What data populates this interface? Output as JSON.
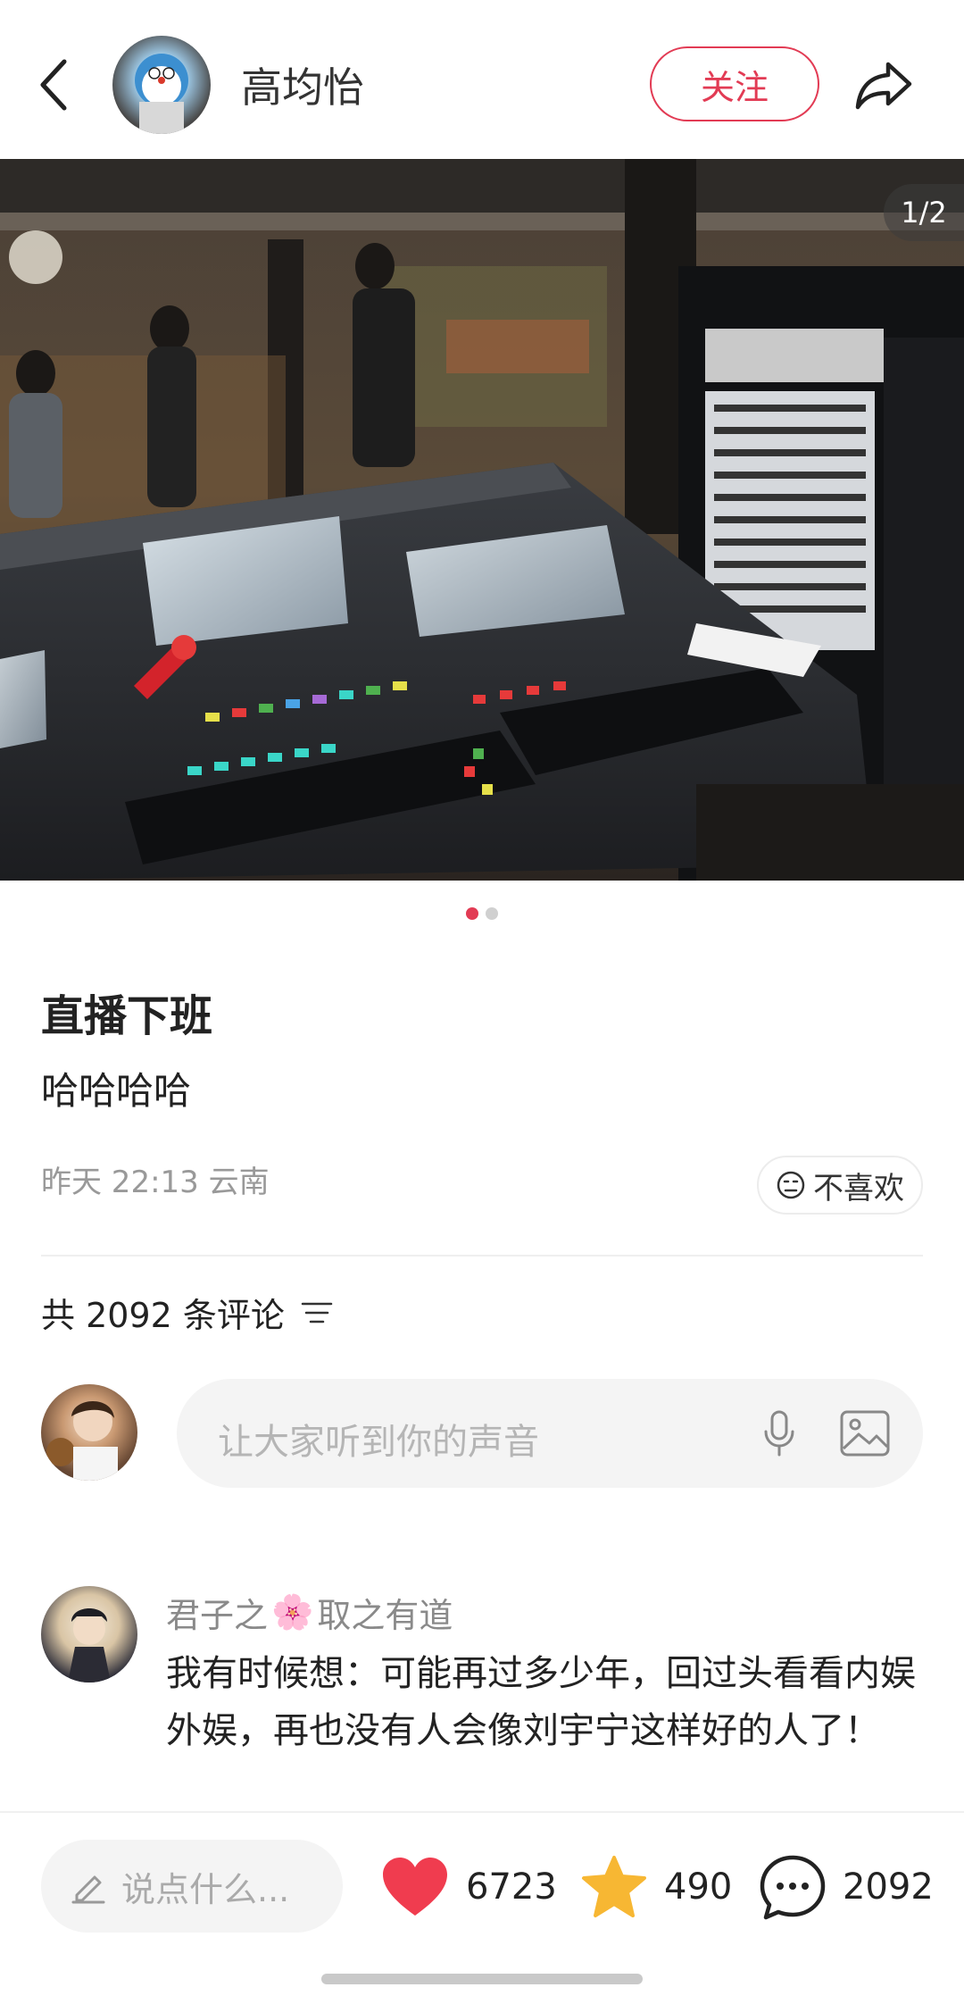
{
  "header": {
    "author_name": "高均怡",
    "follow_label": "关注"
  },
  "photo": {
    "counter": "1/2",
    "current_index": 1,
    "total": 2
  },
  "note": {
    "title": "直播下班",
    "body": "哈哈哈哈",
    "meta": "昨天 22:13 云南",
    "dislike_label": "不喜欢"
  },
  "comments_section": {
    "count_label": "共 2092 条评论",
    "input_placeholder": "让大家听到你的声音"
  },
  "comment": {
    "username_part1": "君子之",
    "username_emoji": "🌸",
    "username_part2": "取之有道",
    "text": "我有时候想：可能再过多少年，回过头看看内娱外娱，再也没有人会像刘宇宁这样好的人了！"
  },
  "bottom_bar": {
    "say_placeholder": "说点什么...",
    "likes": "6723",
    "collects": "490",
    "comments": "2092"
  },
  "colors": {
    "accent": "#e23b54",
    "like": "#f03c4f",
    "star": "#f7b733"
  }
}
